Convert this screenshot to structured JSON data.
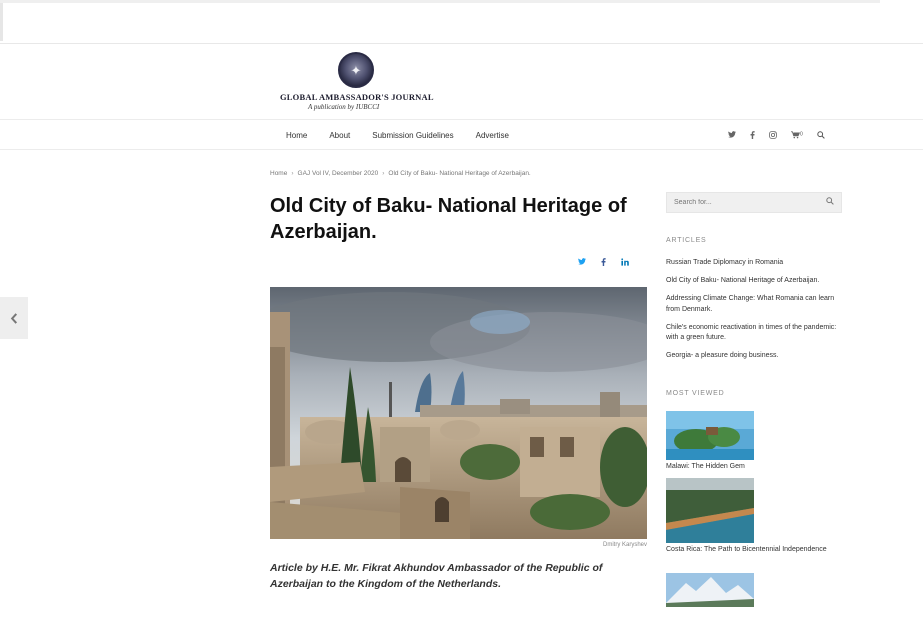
{
  "site": {
    "logo_title": "GLOBAL AMBASSADOR'S JOURNAL",
    "logo_sub": "A publication by IUBCCI"
  },
  "nav": {
    "items": [
      "Home",
      "About",
      "Submission Guidelines",
      "Advertise"
    ],
    "icons": [
      "twitter-icon",
      "facebook-icon",
      "instagram-icon",
      "cart-icon",
      "search-icon"
    ],
    "cart_count": "0"
  },
  "breadcrumb": [
    "Home",
    "GAJ Vol IV, December 2020",
    "Old City of Baku- National Heritage of Azerbaijan."
  ],
  "article": {
    "title": "Old City of Baku- National Heritage of Azerbaijan.",
    "image_credit": "Dmitry Karyshev",
    "lead": "Article by H.E. Mr. Fikrat Akhundov Ambassador of the Republic of Azerbaijan to the Kingdom of the Netherlands."
  },
  "sidebar": {
    "search_placeholder": "Search for...",
    "articles_title": "ARTICLES",
    "articles": [
      "Russian Trade Diplomacy in Romania",
      "Old City of Baku- National Heritage of Azerbaijan.",
      "Addressing Climate Change: What Romania can learn from Denmark.",
      "Chile's economic reactivation in times of the pandemic: with a green future.",
      "Georgia- a pleasure doing business."
    ],
    "most_viewed_title": "MOST VIEWED",
    "most_viewed": [
      "Malawi: The Hidden Gem",
      "Costa Rica: The Path to Bicentennial Independence"
    ]
  },
  "colors": {
    "twitter": "#1da1f2",
    "facebook": "#3b5998",
    "linkedin": "#0077b5",
    "widget_heading": "#8a8a8a"
  }
}
